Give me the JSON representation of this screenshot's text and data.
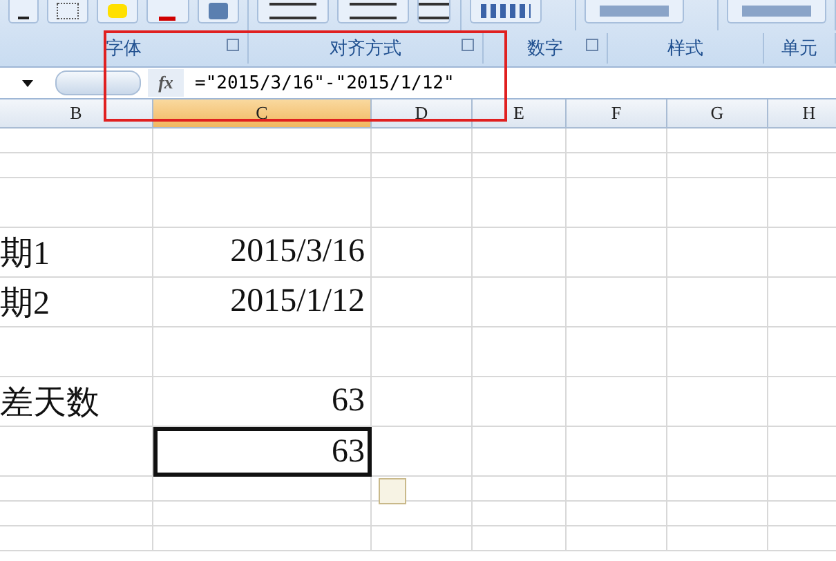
{
  "ribbon": {
    "groups": [
      {
        "label": "字体"
      },
      {
        "label": "对齐方式"
      },
      {
        "label": "数字"
      },
      {
        "label": "样式"
      },
      {
        "label": "单元"
      }
    ]
  },
  "formula_bar": {
    "fx": "fx",
    "formula": "=\"2015/3/16\"-\"2015/1/12\""
  },
  "columns": [
    {
      "label": "B",
      "selected": false
    },
    {
      "label": "C",
      "selected": true
    },
    {
      "label": "D",
      "selected": false
    },
    {
      "label": "E",
      "selected": false
    },
    {
      "label": "F",
      "selected": false
    },
    {
      "label": "G",
      "selected": false
    },
    {
      "label": "H",
      "selected": false
    }
  ],
  "rows": [
    {
      "kind": "short",
      "selected": false
    },
    {
      "kind": "short",
      "selected": false
    },
    {
      "kind": "tall",
      "selected": false
    },
    {
      "kind": "tall",
      "b": "期1",
      "c": "2015/3/16",
      "selected": false
    },
    {
      "kind": "tall",
      "b": "期2",
      "c": "2015/1/12",
      "selected": false
    },
    {
      "kind": "tall",
      "selected": false
    },
    {
      "kind": "tall",
      "b": "差天数",
      "c": "63",
      "selected": false
    },
    {
      "kind": "tall",
      "c": "63",
      "selected": true
    },
    {
      "kind": "short",
      "selected": false
    },
    {
      "kind": "short",
      "selected": false
    },
    {
      "kind": "short",
      "selected": false
    }
  ]
}
